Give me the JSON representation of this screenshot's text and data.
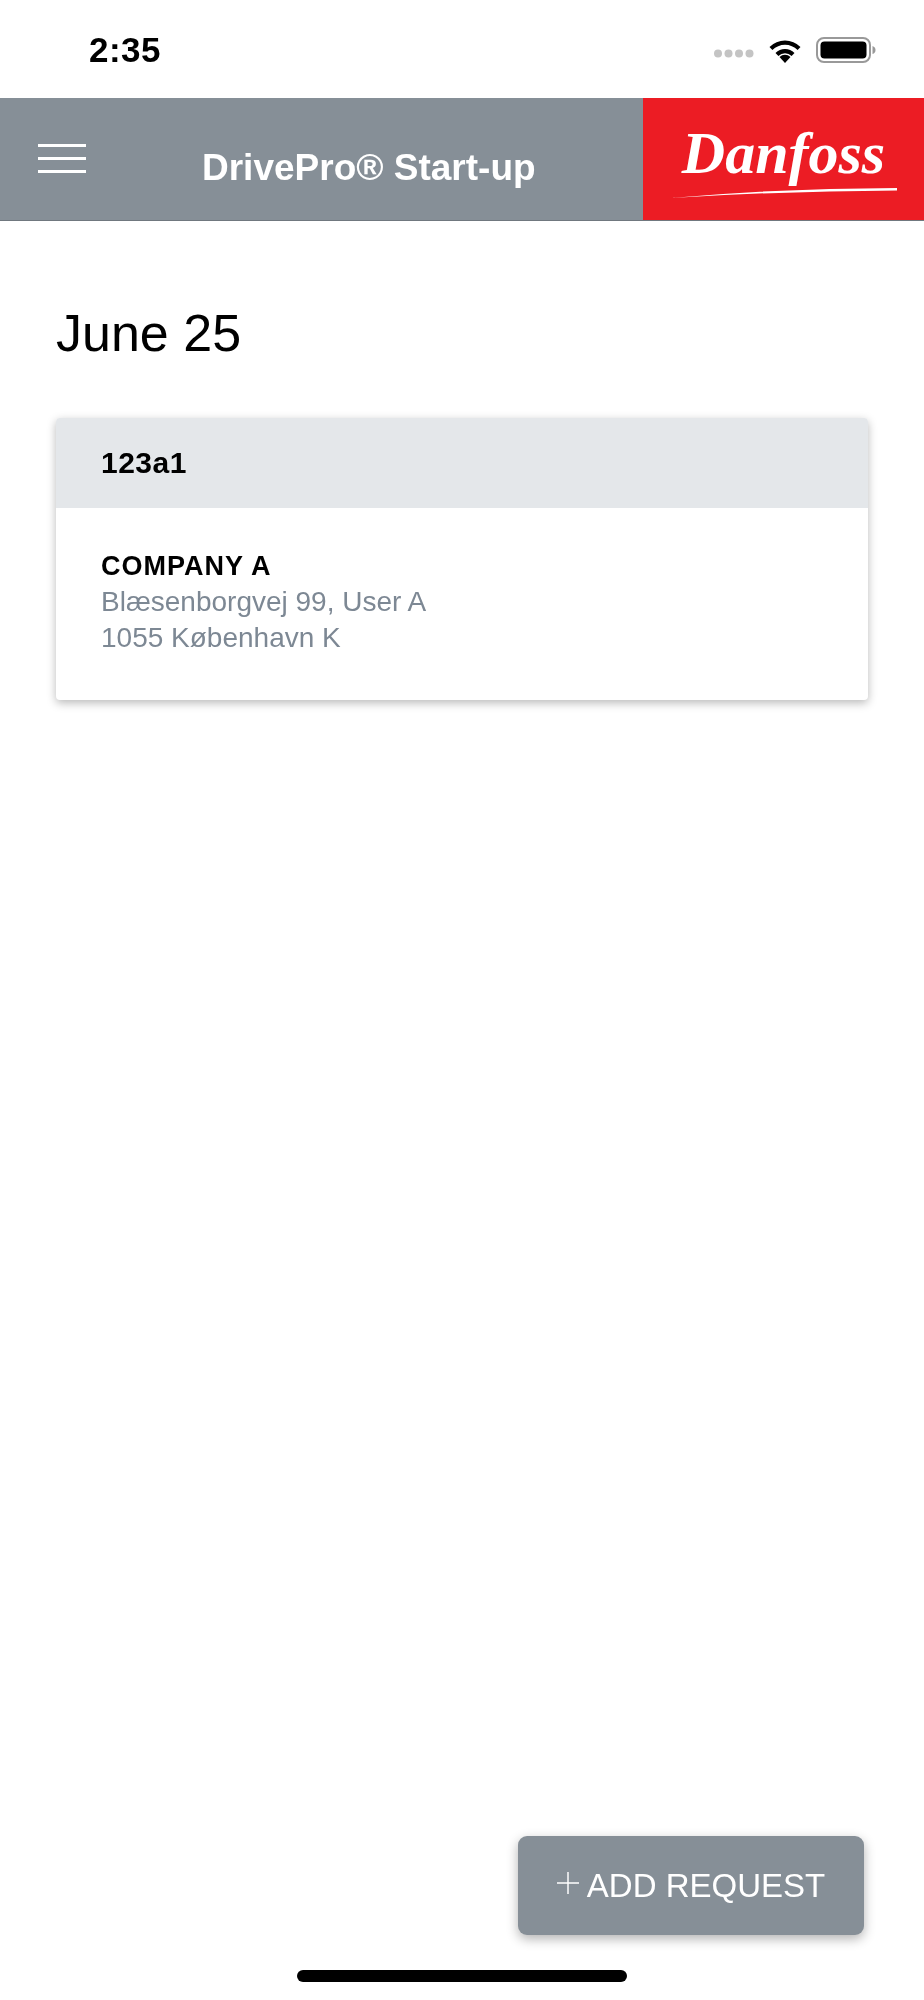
{
  "status_bar": {
    "time": "2:35"
  },
  "header": {
    "title": "DrivePro® Start-up",
    "logo": "Danfoss"
  },
  "date_heading": "June 25",
  "requests": [
    {
      "id": "123a1",
      "company": "COMPANY A",
      "address_lines": [
        "Blæsenborgvej 99, User A",
        "1055 København K"
      ]
    }
  ],
  "add_button": {
    "label": "ADD REQUEST"
  }
}
